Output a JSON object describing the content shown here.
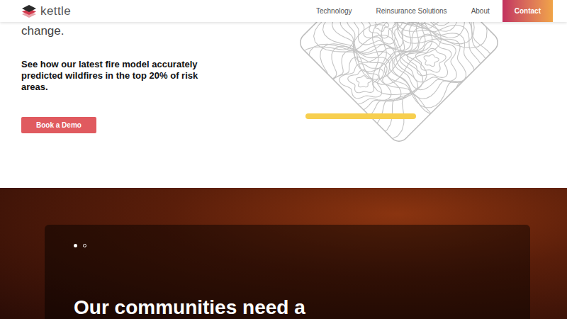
{
  "header": {
    "logo": "kettle",
    "nav": [
      {
        "label": "Technology"
      },
      {
        "label": "Reinsurance Solutions"
      },
      {
        "label": "About"
      }
    ],
    "contact": "Contact"
  },
  "hero": {
    "heading_tail": "change.",
    "subtitle": "See how our latest fire model accurately predicted wildfires in the top 20% of risk areas.",
    "cta": "Book a Demo"
  },
  "carousel": {
    "dots": [
      {
        "selected": true
      },
      {
        "selected": false
      }
    ],
    "heading": "Our communities need a"
  }
}
